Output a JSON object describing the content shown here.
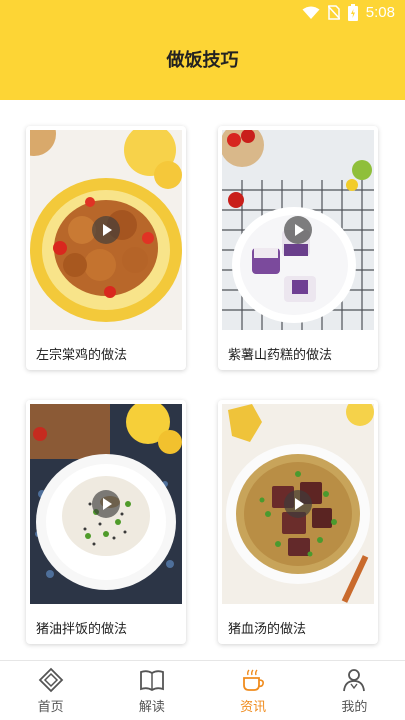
{
  "status_bar": {
    "time": "5:08",
    "icons": [
      "wifi-icon",
      "no-sim-icon",
      "battery-icon"
    ]
  },
  "header": {
    "title": "做饭技巧"
  },
  "colors": {
    "header_bg": "#fdd535",
    "active_tab": "#f08c1e",
    "inactive_tab": "#555555"
  },
  "cards": [
    {
      "title": "左宗棠鸡的做法",
      "icon": "play-icon"
    },
    {
      "title": "紫薯山药糕的做法",
      "icon": "play-icon"
    },
    {
      "title": "猪油拌饭的做法",
      "icon": "play-icon"
    },
    {
      "title": "猪血汤的做法",
      "icon": "play-icon"
    }
  ],
  "tabs": [
    {
      "label": "首页",
      "icon": "home-icon",
      "active": false
    },
    {
      "label": "解读",
      "icon": "book-icon",
      "active": false
    },
    {
      "label": "资讯",
      "icon": "coffee-cup-icon",
      "active": true
    },
    {
      "label": "我的",
      "icon": "user-icon",
      "active": false
    }
  ]
}
